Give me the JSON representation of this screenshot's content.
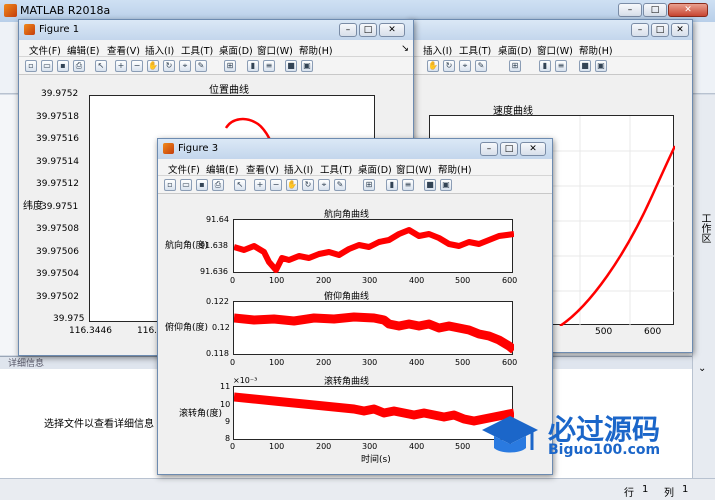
{
  "app": {
    "title": "MATLAB R2018a",
    "right_panel_label": "工作区",
    "detail_panel_label": "详细信息",
    "detail_message": "选择文件以查看详细信息",
    "status": {
      "row_label": "行",
      "row_value": "1",
      "col_label": "列",
      "col_value": "1"
    }
  },
  "figure_menu": [
    "文件(F)",
    "编辑(E)",
    "查看(V)",
    "插入(I)",
    "工具(T)",
    "桌面(D)",
    "窗口(W)",
    "帮助(H)"
  ],
  "fig2": {
    "menu_partial": [
      "插入(I)",
      "工具(T)",
      "桌面(D)",
      "窗口(W)",
      "帮助(H)"
    ],
    "axes_title": "速度曲线",
    "xticks_visible": [
      "500",
      "600"
    ]
  },
  "fig1": {
    "title": "Figure 1",
    "axes_title": "位置曲线",
    "ylabel": "纬度",
    "yticks": [
      "39.9752",
      "39.97518",
      "39.97516",
      "39.97514",
      "39.97512",
      "39.9751",
      "39.97508",
      "39.97506",
      "39.97504",
      "39.97502",
      "39.975"
    ],
    "xticks": [
      "116.3446",
      "116.3"
    ]
  },
  "fig3": {
    "title": "Figure 3",
    "xlabel": "时间(s)",
    "xticks": [
      "0",
      "100",
      "200",
      "300",
      "400",
      "500",
      "600"
    ],
    "subplots": [
      {
        "title": "航向角曲线",
        "ylabel": "航向角(度)",
        "yticks": [
          "91.64",
          "91.638",
          "91.636"
        ]
      },
      {
        "title": "俯仰角曲线",
        "ylabel": "俯仰角(度)",
        "yticks": [
          "0.122",
          "0.12",
          "0.118"
        ]
      },
      {
        "title": "滚转角曲线",
        "ylabel": "滚转角(度)",
        "yticks": [
          "11",
          "10",
          "9",
          "8"
        ],
        "exponent": "×10⁻³"
      }
    ]
  },
  "watermark": {
    "text": "必过源码",
    "url": "Biguo100.com"
  },
  "colors": {
    "line": "#ff0000",
    "titlebar": "#c3d6ec",
    "watermark": "#1b66c9"
  }
}
